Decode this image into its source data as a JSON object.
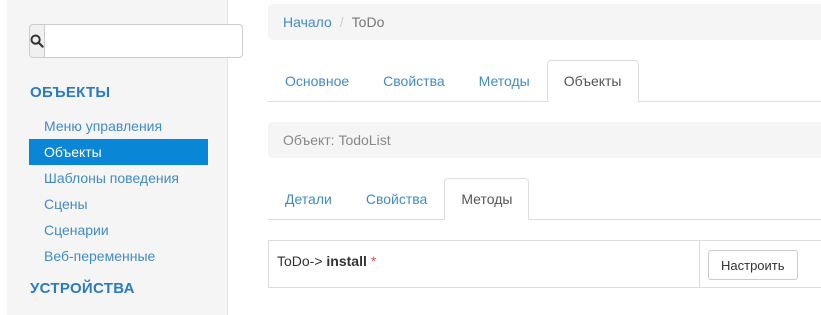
{
  "sidebar": {
    "search": {
      "value": "",
      "placeholder": ""
    },
    "sections": [
      {
        "title": "ОБЪЕКТЫ"
      },
      {
        "title": "УСТРОЙСТВА"
      }
    ],
    "items": [
      {
        "label": "Меню управления"
      },
      {
        "label": "Объекты"
      },
      {
        "label": "Шаблоны поведения"
      },
      {
        "label": "Сцены"
      },
      {
        "label": "Сценарии"
      },
      {
        "label": "Веб-переменные"
      }
    ],
    "active_item": "Объекты"
  },
  "breadcrumb": {
    "home": "Начало",
    "separator": "/",
    "current": "ToDo"
  },
  "main_tabs": [
    {
      "label": "Основное"
    },
    {
      "label": "Свойства"
    },
    {
      "label": "Методы"
    },
    {
      "label": "Объекты"
    }
  ],
  "main_tabs_active": "Объекты",
  "object_label": "Объект: TodoList",
  "sub_tabs": [
    {
      "label": "Детали"
    },
    {
      "label": "Свойства"
    },
    {
      "label": "Методы"
    }
  ],
  "sub_tabs_active": "Методы",
  "methods": [
    {
      "prefix": "ToDo->",
      "name": "install",
      "marker": "*",
      "button": "Настроить"
    }
  ],
  "colors": {
    "link": "#428bca",
    "section_title": "#2a7bbf",
    "active_bg": "#0a86d6",
    "required": "#d9534f"
  }
}
